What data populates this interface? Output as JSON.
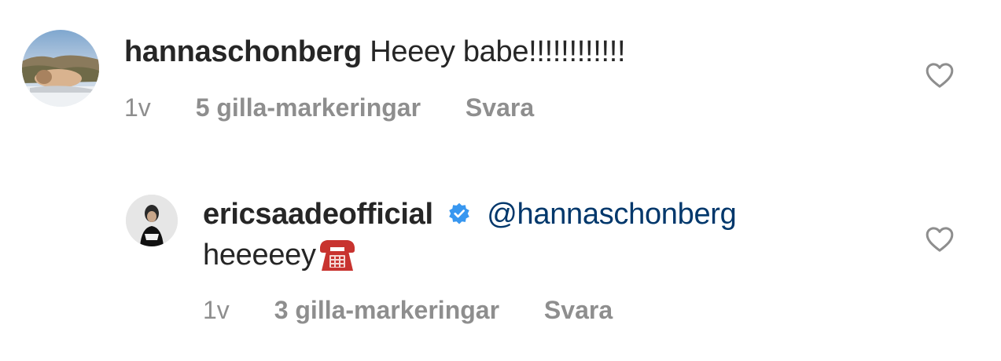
{
  "comments": [
    {
      "username": "hannaschonberg",
      "text": "Heeey babe!!!!!!!!!!!!",
      "age": "1v",
      "likes": "5 gilla-markeringar",
      "reply": "Svara"
    },
    {
      "username": "ericsaadeofficial",
      "verified": true,
      "mention": "@hannaschonberg",
      "text": "heeeeey",
      "emoji": "telephone-icon",
      "age": "1v",
      "likes": "3 gilla-markeringar",
      "reply": "Svara"
    }
  ],
  "colors": {
    "username": "#262626",
    "meta": "#8e8e8e",
    "mention": "#00376b",
    "verified": "#3897f0",
    "heart_stroke": "#8e8e8e"
  }
}
